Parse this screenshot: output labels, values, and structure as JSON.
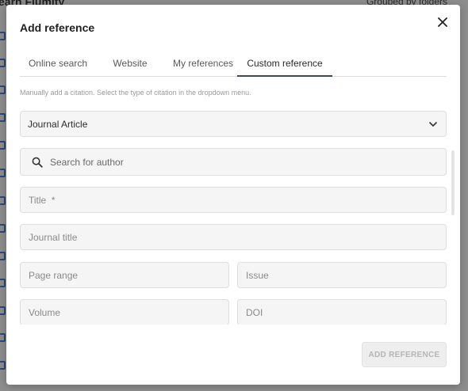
{
  "background": {
    "title": "earn Flumity",
    "grouped_label": "Grouped by folders"
  },
  "modal": {
    "title": "Add reference",
    "close_icon": "close-icon",
    "tabs": [
      {
        "label": "Online search",
        "active": false
      },
      {
        "label": "Website",
        "active": false
      },
      {
        "label": "My references",
        "active": false
      },
      {
        "label": "Custom reference",
        "active": true
      }
    ],
    "hint": "Manually add a citation. Select the type of citation in the dropdown menu.",
    "citation_type": {
      "selected": "Journal Article",
      "icon": "chevron-down-icon"
    },
    "author_search": {
      "placeholder": "Search for author",
      "icon": "search-icon"
    },
    "fields": {
      "title": "Title  *",
      "journal_title": "Journal title",
      "page_range": "Page range",
      "issue": "Issue",
      "volume": "Volume",
      "doi": "DOI"
    },
    "add_button": "ADD REFERENCE"
  },
  "colors": {
    "overlay": "#8d8d8d",
    "tab_indicator": "#3a4a5c",
    "field_bg": "#f5f5f5",
    "disabled_button_text": "#b5b5b5"
  }
}
